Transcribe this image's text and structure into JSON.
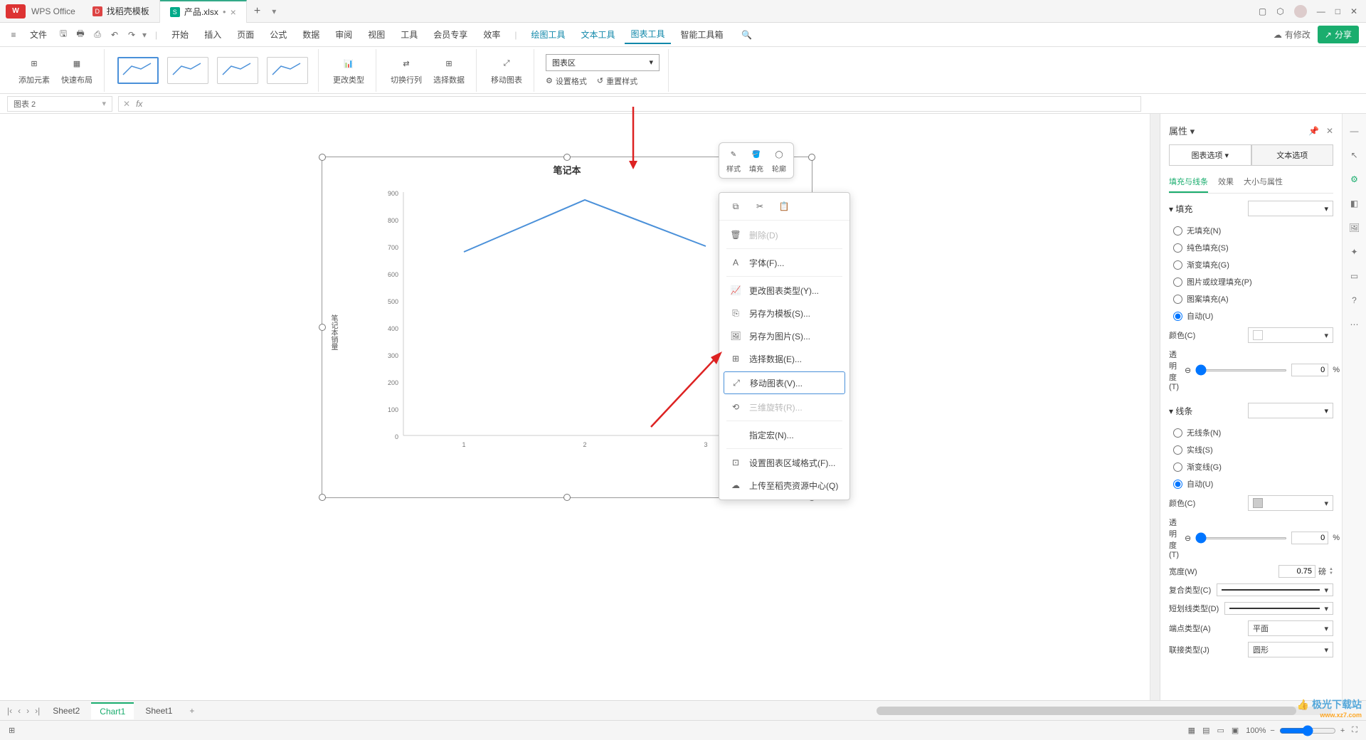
{
  "titlebar": {
    "logo": "W",
    "brand": "WPS Office",
    "tabs": [
      {
        "icon": "D",
        "label": "找稻壳模板",
        "iconColor": "red"
      },
      {
        "icon": "S",
        "label": "产品.xlsx",
        "iconColor": "green",
        "active": true,
        "dirty": "●"
      }
    ]
  },
  "menubar": {
    "file": "文件",
    "items": [
      "开始",
      "插入",
      "页面",
      "公式",
      "数据",
      "审阅",
      "视图",
      "工具",
      "会员专享",
      "效率"
    ],
    "contextual": [
      "绘图工具",
      "文本工具",
      "图表工具",
      "智能工具箱"
    ],
    "active": "图表工具",
    "has_mod": "有修改",
    "share": "分享"
  },
  "ribbon": {
    "add_element": "添加元素",
    "quick_layout": "快速布局",
    "change_type": "更改类型",
    "switch_rc": "切换行列",
    "select_data": "选择数据",
    "move_chart": "移动图表",
    "chart_area_sel": "图表区",
    "set_format": "设置格式",
    "reset_style": "重置样式"
  },
  "formula": {
    "name": "图表 2"
  },
  "chart_data": {
    "type": "line",
    "title": "笔记本",
    "ylabel": "笔记本销量",
    "categories": [
      "1",
      "2",
      "3"
    ],
    "values": [
      680,
      870,
      700
    ],
    "y_ticks": [
      0,
      100,
      200,
      300,
      400,
      500,
      600,
      700,
      800,
      900
    ],
    "ylim": [
      0,
      900
    ]
  },
  "mini_toolbar": {
    "style": "样式",
    "fill": "填充",
    "outline": "轮廓"
  },
  "context_menu": {
    "delete": "删除(D)",
    "font": "字体(F)...",
    "change_type": "更改图表类型(Y)...",
    "save_template": "另存为模板(S)...",
    "save_image": "另存为图片(S)...",
    "select_data": "选择数据(E)...",
    "move_chart": "移动图表(V)...",
    "rotate_3d": "三维旋转(R)...",
    "assign_macro": "指定宏(N)...",
    "set_area_format": "设置图表区域格式(F)...",
    "upload": "上传至稻壳资源中心(Q)"
  },
  "panel": {
    "title": "属性",
    "tab_chart": "图表选项",
    "tab_text": "文本选项",
    "sub_fill": "填充与线条",
    "sub_effect": "效果",
    "sub_size": "大小与属性",
    "fill_section": "填充",
    "fill": {
      "none": "无填充(N)",
      "solid": "纯色填充(S)",
      "gradient": "渐变填充(G)",
      "picture": "图片或纹理填充(P)",
      "pattern": "图案填充(A)",
      "auto": "自动(U)"
    },
    "color": "颜色(C)",
    "transparency": "透明度(T)",
    "trans_val": "0",
    "pct": "%",
    "line_section": "线条",
    "line": {
      "none": "无线条(N)",
      "solid": "实线(S)",
      "gradient": "渐变线(G)",
      "auto": "自动(U)"
    },
    "width": "宽度(W)",
    "width_val": "0.75",
    "width_unit": "磅",
    "compound": "复合类型(C)",
    "dash": "短划线类型(D)",
    "cap": "端点类型(A)",
    "cap_val": "平面",
    "join": "联接类型(J)",
    "join_val": "圆形"
  },
  "sheets": {
    "items": [
      "Sheet2",
      "Chart1",
      "Sheet1"
    ],
    "active": "Chart1"
  },
  "status": {
    "zoom": "100%"
  }
}
